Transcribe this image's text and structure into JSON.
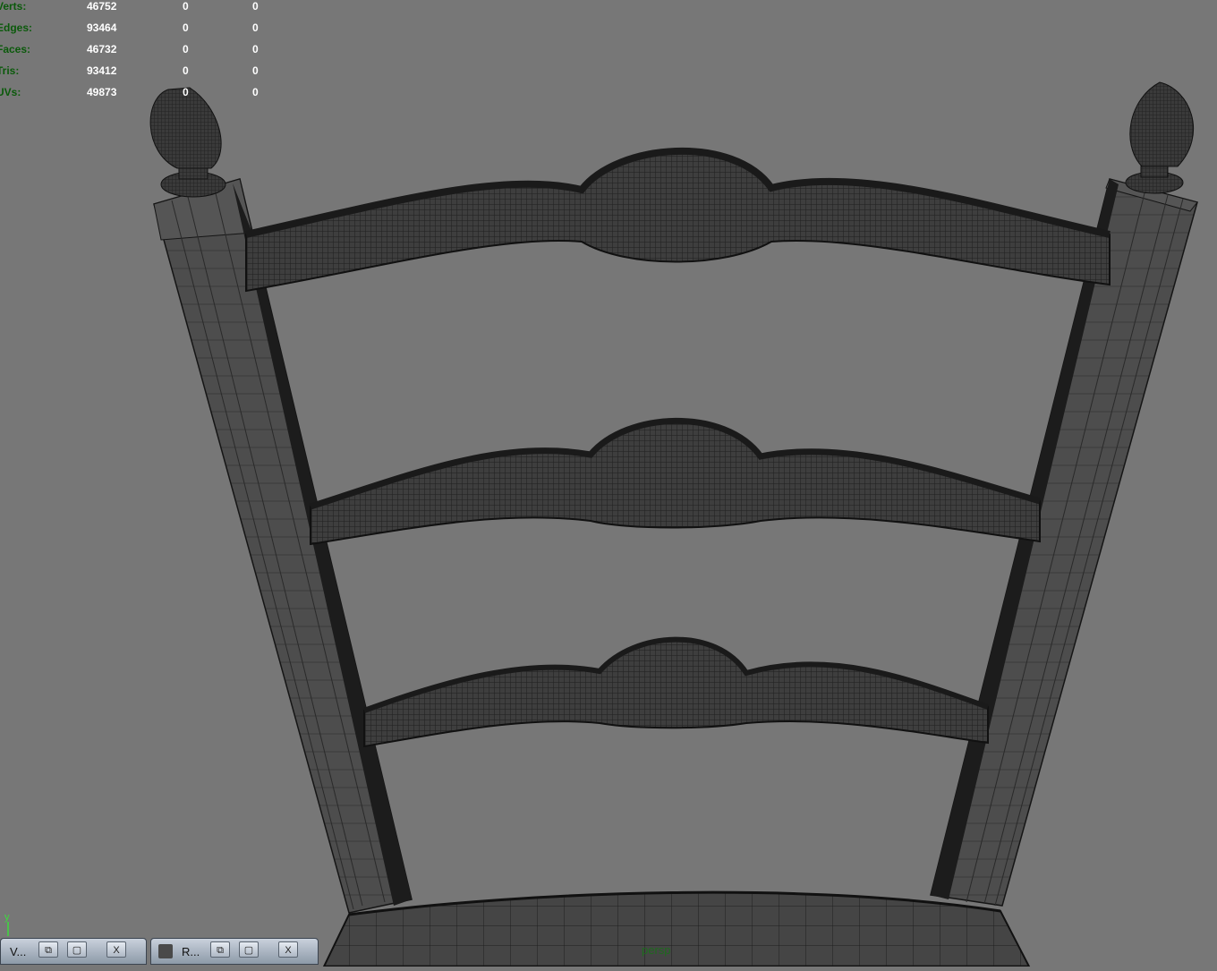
{
  "heads_up": {
    "rows": [
      {
        "label": "Verts:",
        "value": "46752",
        "selected": "0",
        "components": "0"
      },
      {
        "label": "Edges:",
        "value": "93464",
        "selected": "0",
        "components": "0"
      },
      {
        "label": "Faces:",
        "value": "46732",
        "selected": "0",
        "components": "0"
      },
      {
        "label": "Tris:",
        "value": "93412",
        "selected": "0",
        "components": "0"
      },
      {
        "label": "UVs:",
        "value": "49873",
        "selected": "0",
        "components": "0"
      }
    ]
  },
  "viewport": {
    "camera_label": "persp",
    "axis_label": "y"
  },
  "taskbar": {
    "windows": [
      {
        "title": "V...",
        "restore": "⧉",
        "maximize": "▢",
        "close": "X"
      },
      {
        "title": "R...",
        "restore": "⧉",
        "maximize": "▢",
        "close": "X"
      }
    ]
  }
}
